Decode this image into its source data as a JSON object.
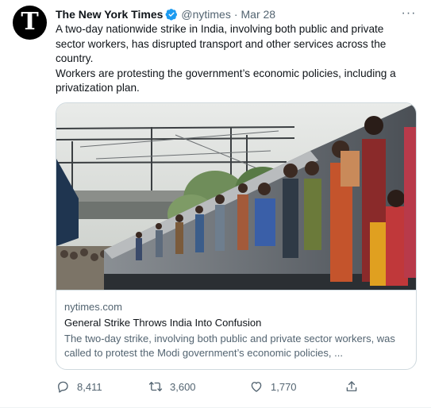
{
  "tweet": {
    "author_name": "The New York Times",
    "handle": "@nytimes",
    "separator": "·",
    "date": "Mar 28",
    "more_label": "···",
    "avatar_glyph": "T",
    "text_line_1": "A two-day nationwide strike in India, involving both public and private sector workers, has disrupted transport and other services across the country.",
    "text_line_2": "Workers are protesting the government’s economic policies, including a privatization plan."
  },
  "card": {
    "domain": "nytimes.com",
    "title": "General Strike Throws India Into Confusion",
    "description": "The two-day strike, involving both public and private sector workers, was called to protest the Modi government’s economic policies, ..."
  },
  "actions": {
    "replies": "8,411",
    "retweets": "3,600",
    "likes": "1,770"
  },
  "icons": {
    "verified": "verified-badge-icon",
    "reply": "reply-icon",
    "retweet": "retweet-icon",
    "like": "heart-icon",
    "share": "share-icon",
    "more": "more-icon"
  },
  "colors": {
    "verified": "#1d9bf0",
    "secondary_text": "#536471",
    "border": "#cfd9de"
  }
}
